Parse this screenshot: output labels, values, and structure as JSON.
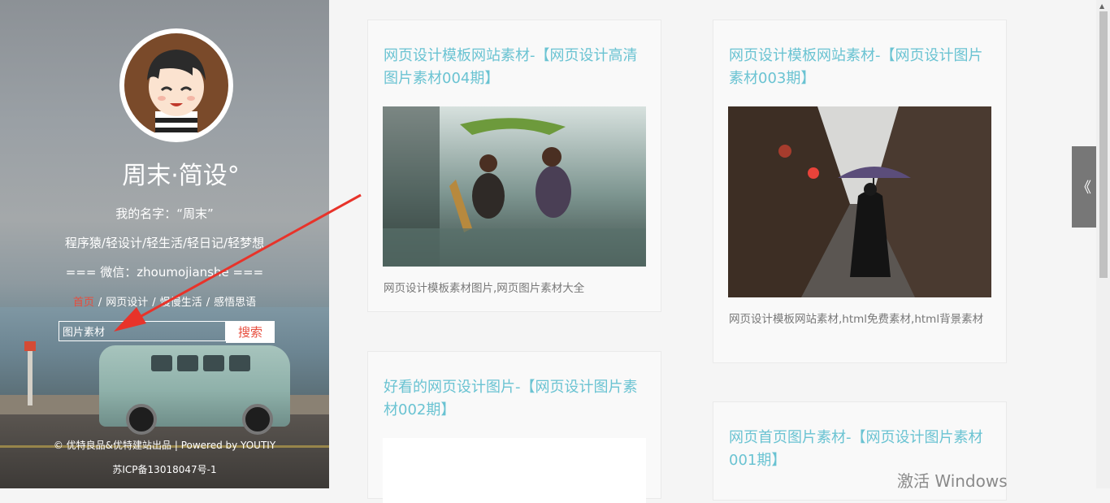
{
  "sidebar": {
    "title": "周末·简设°",
    "name_line": "我的名字：“周末”",
    "tags_line": "程序猿/轻设计/轻生活/轻日记/轻梦想",
    "wechat_line": "=== 微信：zhoumojianshe ===",
    "nav": [
      "首页",
      "网页设计",
      "慢慢生活",
      "感悟思语"
    ],
    "search": {
      "value": "图片素材",
      "button": "搜索"
    },
    "footer_line1": "© 优特良品&优特建站出品 | Powered by YOUTIY",
    "footer_line2": "苏ICP备13018047号-1"
  },
  "cards": [
    {
      "title": "网页设计模板网站素材-【网页设计高清图片素材004期】",
      "description": "网页设计模板素材图片,网页图片素材大全"
    },
    {
      "title": "网页设计模板网站素材-【网页设计图片素材003期】",
      "description": "网页设计模板网站素材,html免费素材,html背景素材"
    },
    {
      "title": "好看的网页设计图片-【网页设计图片素材002期】",
      "description": ""
    },
    {
      "title": "网页首页图片素材-【网页设计图片素材001期】",
      "description": ""
    }
  ],
  "side_toggle": "《",
  "watermark": "激活 Windows",
  "colors": {
    "accent": "#6ac3d2",
    "active_nav": "#e74c3c",
    "arrow": "#e8332a"
  }
}
